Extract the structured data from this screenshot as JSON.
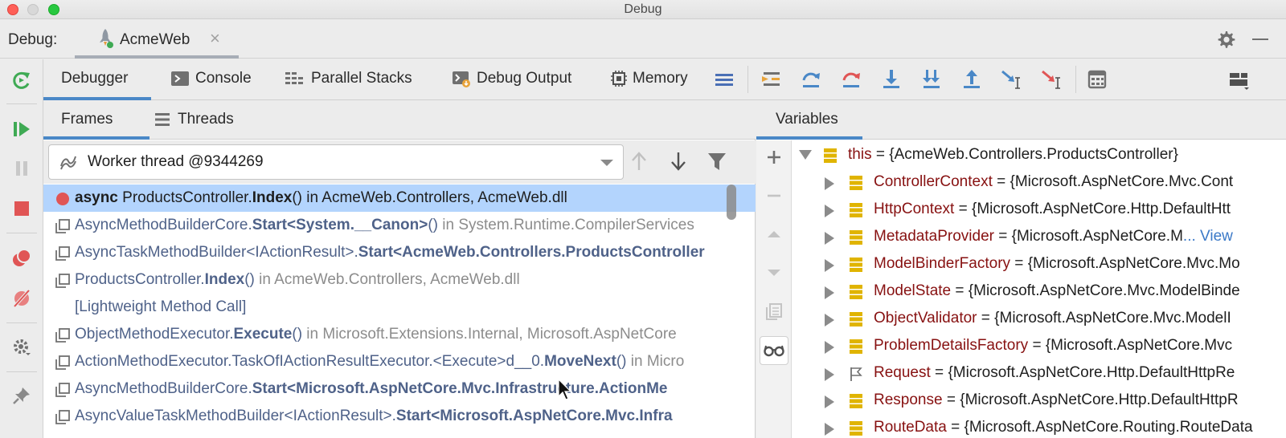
{
  "window": {
    "title": "Debug"
  },
  "debug_header": {
    "label": "Debug:",
    "session_name": "AcmeWeb",
    "close_glyph": "×"
  },
  "tabs": [
    {
      "label": "Debugger",
      "icon": "",
      "active": true
    },
    {
      "label": "Console",
      "icon": "console-icon",
      "active": false
    },
    {
      "label": "Parallel Stacks",
      "icon": "parallel-stacks-icon",
      "active": false
    },
    {
      "label": "Debug Output",
      "icon": "debug-output-icon",
      "active": false
    },
    {
      "label": "Memory",
      "icon": "memory-icon",
      "active": false
    }
  ],
  "subtabs": {
    "frames": "Frames",
    "threads": "Threads"
  },
  "thread_selector": {
    "value": "Worker thread @9344269"
  },
  "frames": [
    {
      "parts": [
        {
          "t": "async ",
          "s": "bold"
        },
        {
          "t": "ProductsController.",
          "s": "normal"
        },
        {
          "t": "Index",
          "s": "bold"
        },
        {
          "t": "() in AcmeWeb.Controllers, AcmeWeb.dll",
          "s": "normal"
        }
      ],
      "icon": "breakpoint",
      "selected": true
    },
    {
      "parts": [
        {
          "t": "AsyncMethodBuilderCore.",
          "s": "dim"
        },
        {
          "t": "Start<System.__Canon>",
          "s": "dimbold"
        },
        {
          "t": "()",
          "s": "dim"
        },
        {
          "t": " in System.Runtime.CompilerServices",
          "s": "gray"
        }
      ],
      "icon": "frame",
      "selected": false
    },
    {
      "parts": [
        {
          "t": "AsyncTaskMethodBuilder<IActionResult>.",
          "s": "dim"
        },
        {
          "t": "Start<AcmeWeb.Controllers.ProductsController",
          "s": "dimbold"
        }
      ],
      "icon": "frame",
      "selected": false
    },
    {
      "parts": [
        {
          "t": "ProductsController.",
          "s": "dim"
        },
        {
          "t": "Index",
          "s": "dimbold"
        },
        {
          "t": "()",
          "s": "dim"
        },
        {
          "t": " in AcmeWeb.Controllers, AcmeWeb.dll",
          "s": "gray"
        }
      ],
      "icon": "frame",
      "selected": false
    },
    {
      "parts": [
        {
          "t": "[Lightweight Method Call]",
          "s": "dim"
        }
      ],
      "icon": "",
      "selected": false
    },
    {
      "parts": [
        {
          "t": "ObjectMethodExecutor.",
          "s": "dim"
        },
        {
          "t": "Execute",
          "s": "dimbold"
        },
        {
          "t": "()",
          "s": "dim"
        },
        {
          "t": " in Microsoft.Extensions.Internal, Microsoft.AspNetCore",
          "s": "gray"
        }
      ],
      "icon": "frame",
      "selected": false
    },
    {
      "parts": [
        {
          "t": "ActionMethodExecutor.TaskOfIActionResultExecutor.<Execute>d__0.",
          "s": "dim"
        },
        {
          "t": "MoveNext",
          "s": "dimbold"
        },
        {
          "t": "()",
          "s": "dim"
        },
        {
          "t": " in Micro",
          "s": "gray"
        }
      ],
      "icon": "frame",
      "selected": false
    },
    {
      "parts": [
        {
          "t": "AsyncMethodBuilderCore.",
          "s": "dim"
        },
        {
          "t": "Start<Microsoft.AspNetCore.Mvc.Infrastructure.ActionMe",
          "s": "dimbold"
        }
      ],
      "icon": "frame",
      "selected": false
    },
    {
      "parts": [
        {
          "t": "AsyncValueTaskMethodBuilder<IActionResult>.",
          "s": "dim"
        },
        {
          "t": "Start<Microsoft.AspNetCore.Mvc.Infra",
          "s": "dimbold"
        }
      ],
      "icon": "frame",
      "selected": false
    }
  ],
  "variables_tab": "Variables",
  "variables": [
    {
      "name": "this",
      "value": "{AcmeWeb.Controllers.ProductsController}",
      "expanded": true,
      "level": 0,
      "icon": "field"
    },
    {
      "name": "ControllerContext",
      "value": "{Microsoft.AspNetCore.Mvc.Cont",
      "expanded": false,
      "level": 1,
      "icon": "field"
    },
    {
      "name": "HttpContext",
      "value": "{Microsoft.AspNetCore.Http.DefaultHtt",
      "expanded": false,
      "level": 1,
      "icon": "field"
    },
    {
      "name": "MetadataProvider",
      "value": "{Microsoft.AspNetCore.M",
      "link": "... View",
      "expanded": false,
      "level": 1,
      "icon": "field"
    },
    {
      "name": "ModelBinderFactory",
      "value": "{Microsoft.AspNetCore.Mvc.Mo",
      "expanded": false,
      "level": 1,
      "icon": "field"
    },
    {
      "name": "ModelState",
      "value": "{Microsoft.AspNetCore.Mvc.ModelBinde",
      "expanded": false,
      "level": 1,
      "icon": "field"
    },
    {
      "name": "ObjectValidator",
      "value": "{Microsoft.AspNetCore.Mvc.ModelI",
      "expanded": false,
      "level": 1,
      "icon": "field"
    },
    {
      "name": "ProblemDetailsFactory",
      "value": "{Microsoft.AspNetCore.Mvc",
      "expanded": false,
      "level": 1,
      "icon": "field"
    },
    {
      "name": "Request",
      "value": "{Microsoft.AspNetCore.Http.DefaultHttpRe",
      "expanded": false,
      "level": 1,
      "icon": "flag"
    },
    {
      "name": "Response",
      "value": "{Microsoft.AspNetCore.Http.DefaultHttpR",
      "expanded": false,
      "level": 1,
      "icon": "field"
    },
    {
      "name": "RouteData",
      "value": "{Microsoft.AspNetCore.Routing.RouteData",
      "expanded": false,
      "level": 1,
      "icon": "field"
    }
  ],
  "colors": {
    "accent": "#4a88c7",
    "selection": "#b3d4fd",
    "var_name": "#871111",
    "resume_green": "#3faa54",
    "stop_red": "#e05555"
  }
}
